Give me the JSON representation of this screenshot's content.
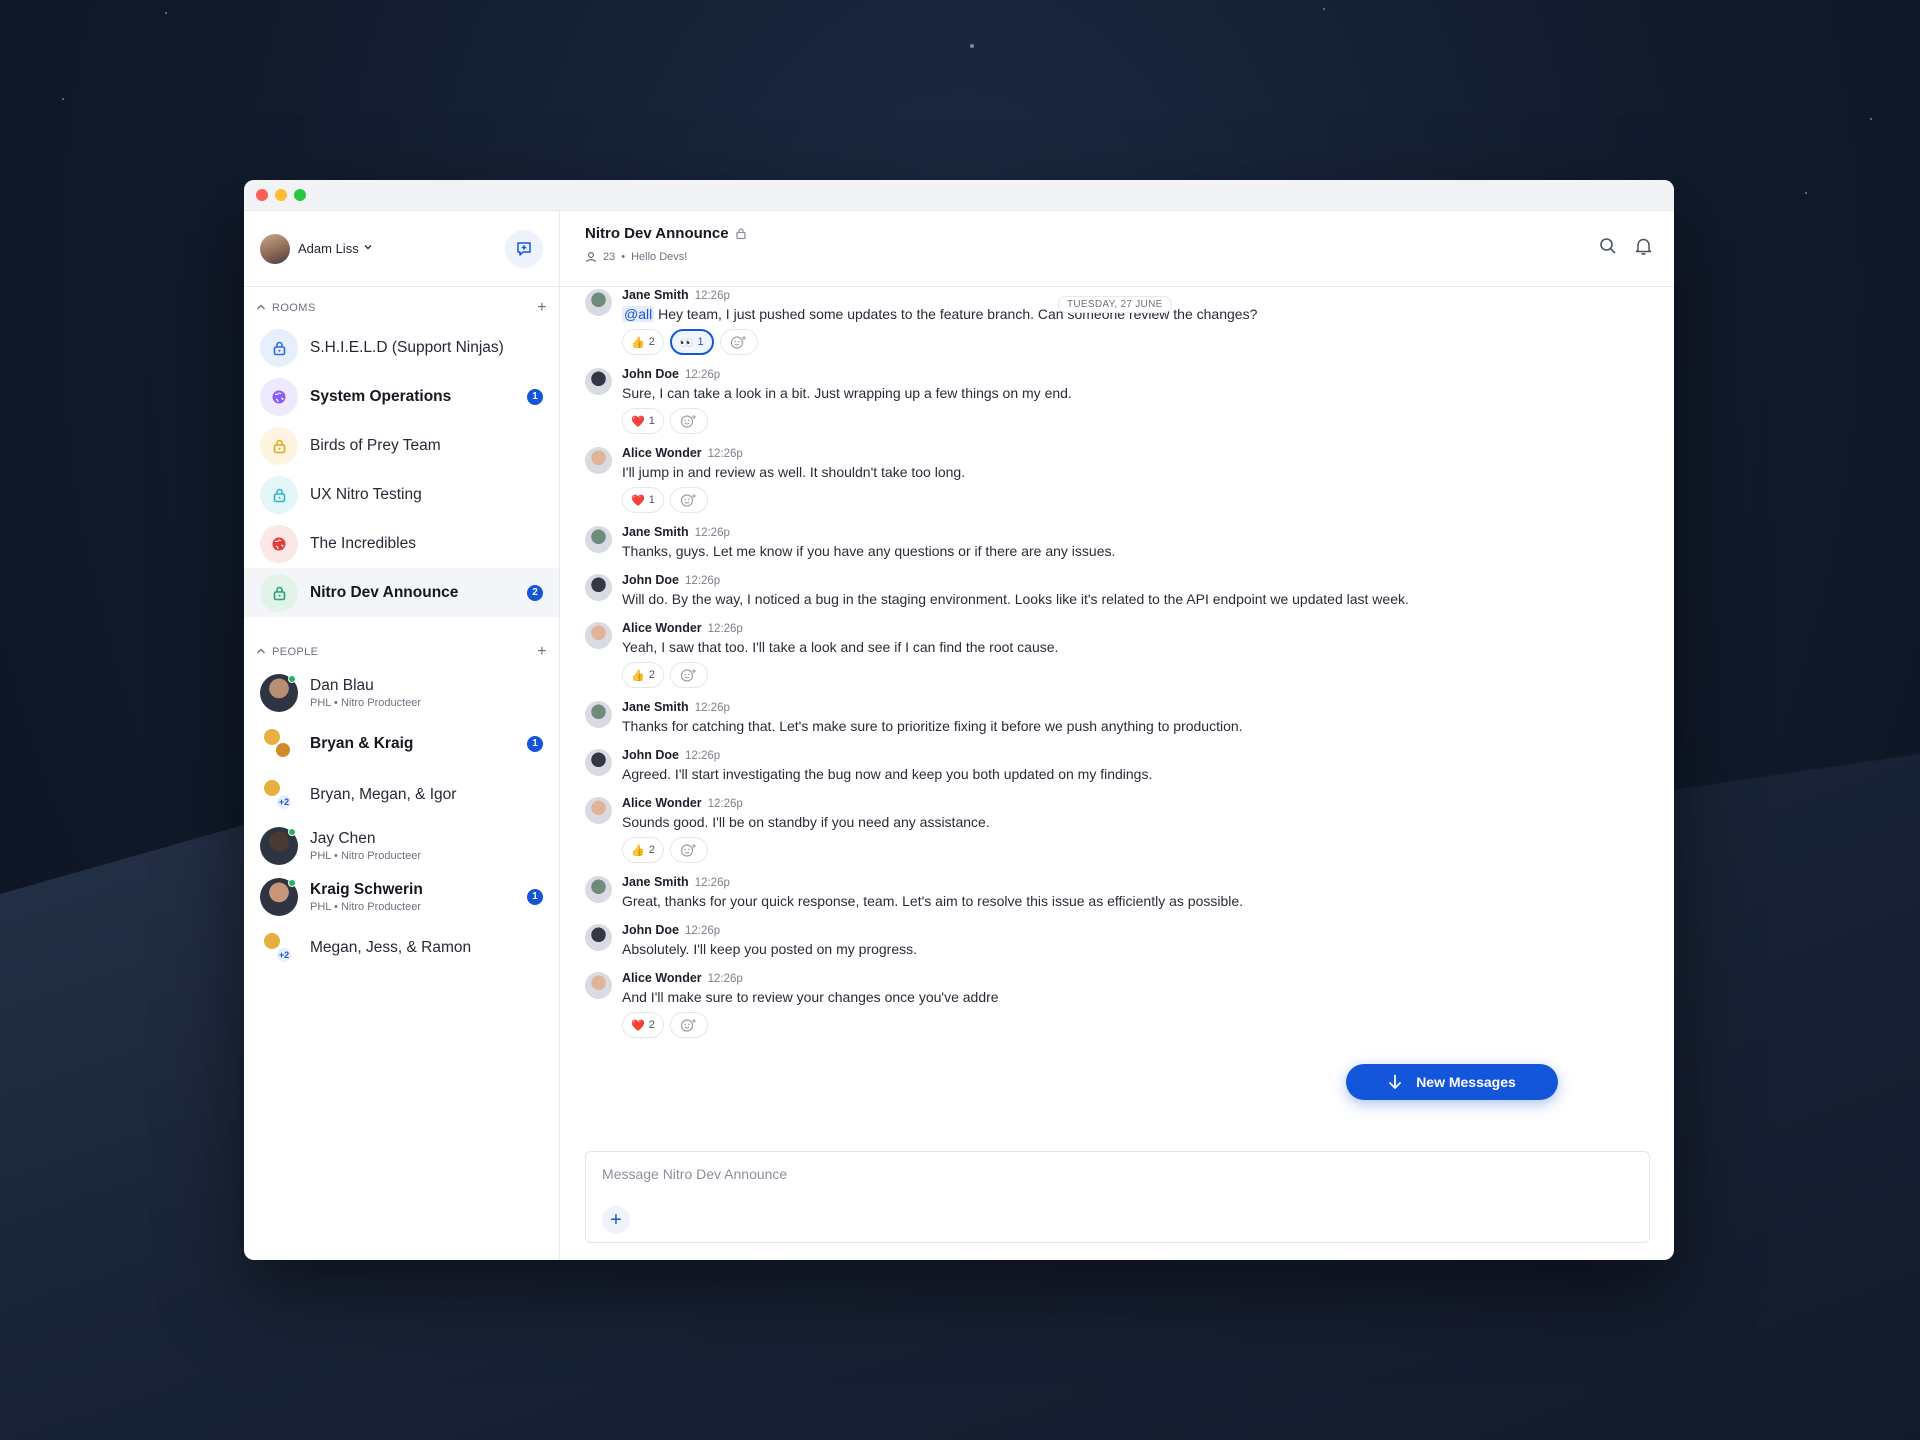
{
  "window": {
    "title": ""
  },
  "user": {
    "name": "Adam Liss"
  },
  "sidebar": {
    "rooms_label": "ROOMS",
    "people_label": "PEOPLE",
    "rooms": [
      {
        "label": "S.H.I.E.L.D (Support Ninjas)",
        "icon": "lock-icon",
        "color": "#2b6be0",
        "bg": "#e8effc",
        "bold": false,
        "badge": ""
      },
      {
        "label": "System Operations",
        "icon": "globe-icon",
        "color": "#8b5cf6",
        "bg": "#efe9fd",
        "bold": true,
        "badge": "1"
      },
      {
        "label": "Birds of Prey Team",
        "icon": "lock-icon",
        "color": "#e2a91a",
        "bg": "#fdf5e2",
        "bold": false,
        "badge": ""
      },
      {
        "label": "UX Nitro Testing",
        "icon": "lock-icon",
        "color": "#2bb6c7",
        "bg": "#e4f6f8",
        "bold": false,
        "badge": ""
      },
      {
        "label": "The Incredibles",
        "icon": "globe-icon",
        "color": "#e23a3a",
        "bg": "#fce7e7",
        "bold": false,
        "badge": ""
      },
      {
        "label": "Nitro Dev Announce",
        "icon": "lock-icon",
        "color": "#23a36a",
        "bg": "#e2f4ea",
        "bold": true,
        "badge": "2"
      }
    ],
    "people": [
      {
        "name": "Dan Blau",
        "sub": "PHL • Nitro Producteer",
        "bold": false,
        "badge": "",
        "online": true,
        "type": "person"
      },
      {
        "name": "Bryan & Kraig",
        "sub": "",
        "bold": true,
        "badge": "1",
        "online": false,
        "type": "group"
      },
      {
        "name": "Bryan, Megan, & Igor",
        "sub": "",
        "bold": false,
        "badge": "",
        "online": false,
        "type": "group-plus",
        "plus": "+2"
      },
      {
        "name": "Jay Chen",
        "sub": "PHL • Nitro Producteer",
        "bold": false,
        "badge": "",
        "online": true,
        "type": "person"
      },
      {
        "name": "Kraig Schwerin",
        "sub": "PHL • Nitro Producteer",
        "bold": true,
        "badge": "1",
        "online": true,
        "type": "person"
      },
      {
        "name": "Megan, Jess, & Ramon",
        "sub": "",
        "bold": false,
        "badge": "",
        "online": false,
        "type": "group-plus",
        "plus": "+2"
      }
    ]
  },
  "channel": {
    "title": "Nitro Dev Announce",
    "members": "23",
    "separator": "•",
    "topic": "Hello Devs!",
    "date_divider": "TUESDAY, 27 JUNE"
  },
  "messages": [
    {
      "author": "Jane Smith",
      "time": "12:26p",
      "mention": "@all",
      "text": " Hey team, I just pushed some updates to the feature branch. Can someone review the changes?",
      "reactions": [
        {
          "emoji": "👍",
          "count": "2",
          "selected": false
        },
        {
          "emoji": "👀",
          "count": "1",
          "selected": true
        }
      ]
    },
    {
      "author": "John Doe",
      "time": "12:26p",
      "mention": "",
      "text": "Sure, I can take a look in a bit. Just wrapping up a few things on my end.",
      "reactions": [
        {
          "emoji": "❤️",
          "count": "1",
          "selected": false
        }
      ]
    },
    {
      "author": "Alice Wonder",
      "time": "12:26p",
      "mention": "",
      "text": "I'll jump in and review as well. It shouldn't take too long.",
      "reactions": [
        {
          "emoji": "❤️",
          "count": "1",
          "selected": false
        }
      ]
    },
    {
      "author": "Jane Smith",
      "time": "12:26p",
      "mention": "",
      "text": "Thanks, guys. Let me know if you have any questions or if there are any issues.",
      "reactions": []
    },
    {
      "author": "John Doe",
      "time": "12:26p",
      "mention": "",
      "text": "Will do. By the way, I noticed a bug in the staging environment. Looks like it's related to the API endpoint we updated last week.",
      "reactions": []
    },
    {
      "author": "Alice Wonder",
      "time": "12:26p",
      "mention": "",
      "text": "Yeah, I saw that too. I'll take a look and see if I can find the root cause.",
      "reactions": [
        {
          "emoji": "👍",
          "count": "2",
          "selected": false
        }
      ]
    },
    {
      "author": "Jane Smith",
      "time": "12:26p",
      "mention": "",
      "text": "Thanks for catching that. Let's make sure to prioritize fixing it before we push anything to production.",
      "reactions": []
    },
    {
      "author": "John Doe",
      "time": "12:26p",
      "mention": "",
      "text": "Agreed. I'll start investigating the bug now and keep you both updated on my findings.",
      "reactions": []
    },
    {
      "author": "Alice Wonder",
      "time": "12:26p",
      "mention": "",
      "text": "Sounds good. I'll be on standby if you need any assistance.",
      "reactions": [
        {
          "emoji": "👍",
          "count": "2",
          "selected": false
        }
      ]
    },
    {
      "author": "Jane Smith",
      "time": "12:26p",
      "mention": "",
      "text": "Great, thanks for your quick response, team. Let's aim to resolve this issue as efficiently as possible.",
      "reactions": []
    },
    {
      "author": "John Doe",
      "time": "12:26p",
      "mention": "",
      "text": "Absolutely. I'll keep you posted on my progress.",
      "reactions": []
    },
    {
      "author": "Alice Wonder",
      "time": "12:26p",
      "mention": "",
      "text": "And I'll make sure to review your changes once you've addre",
      "reactions": [
        {
          "emoji": "❤️",
          "count": "2",
          "selected": false
        }
      ]
    }
  ],
  "new_messages_label": "New Messages",
  "composer": {
    "placeholder": "Message Nitro Dev Announce"
  },
  "colors": {
    "accent": "#1456d9",
    "online": "#22b35e"
  }
}
